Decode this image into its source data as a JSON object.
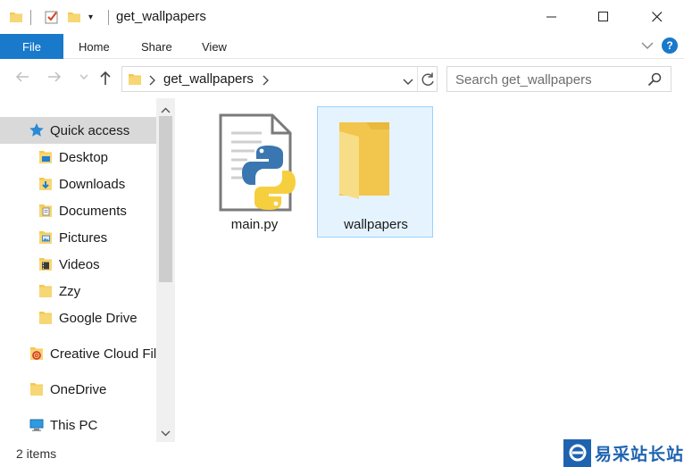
{
  "window": {
    "title": "get_wallpapers"
  },
  "ribbon": {
    "tabs": [
      "File",
      "Home",
      "Share",
      "View"
    ],
    "help_label": "?"
  },
  "address": {
    "crumb": "get_wallpapers",
    "search_placeholder": "Search get_wallpapers"
  },
  "nav": {
    "items": [
      {
        "label": "Quick access",
        "icon": "star-icon"
      },
      {
        "label": "Desktop",
        "icon": "desktop-folder-icon",
        "pinned": true
      },
      {
        "label": "Downloads",
        "icon": "downloads-folder-icon",
        "pinned": true
      },
      {
        "label": "Documents",
        "icon": "documents-folder-icon",
        "pinned": true
      },
      {
        "label": "Pictures",
        "icon": "pictures-folder-icon",
        "pinned": true
      },
      {
        "label": "Videos",
        "icon": "videos-folder-icon",
        "pinned": true
      },
      {
        "label": "Zzy",
        "icon": "folder-icon",
        "pinned": true
      },
      {
        "label": "Google Drive",
        "icon": "folder-icon",
        "pinned": true
      },
      {
        "label": "Creative Cloud Files",
        "icon": "creative-cloud-icon"
      },
      {
        "label": "OneDrive",
        "icon": "folder-icon"
      },
      {
        "label": "This PC",
        "icon": "computer-icon"
      }
    ]
  },
  "files": [
    {
      "name": "main.py",
      "icon": "python-file-icon",
      "selected": false
    },
    {
      "name": "wallpapers",
      "icon": "folder-icon",
      "selected": true
    }
  ],
  "status": {
    "item_count": "2 items"
  },
  "watermark": {
    "text": "易采站长站"
  },
  "colors": {
    "accent": "#1979ca",
    "folder": "#f7d674",
    "selection_bg": "#e5f3ff",
    "selection_border": "#99d1ff"
  }
}
